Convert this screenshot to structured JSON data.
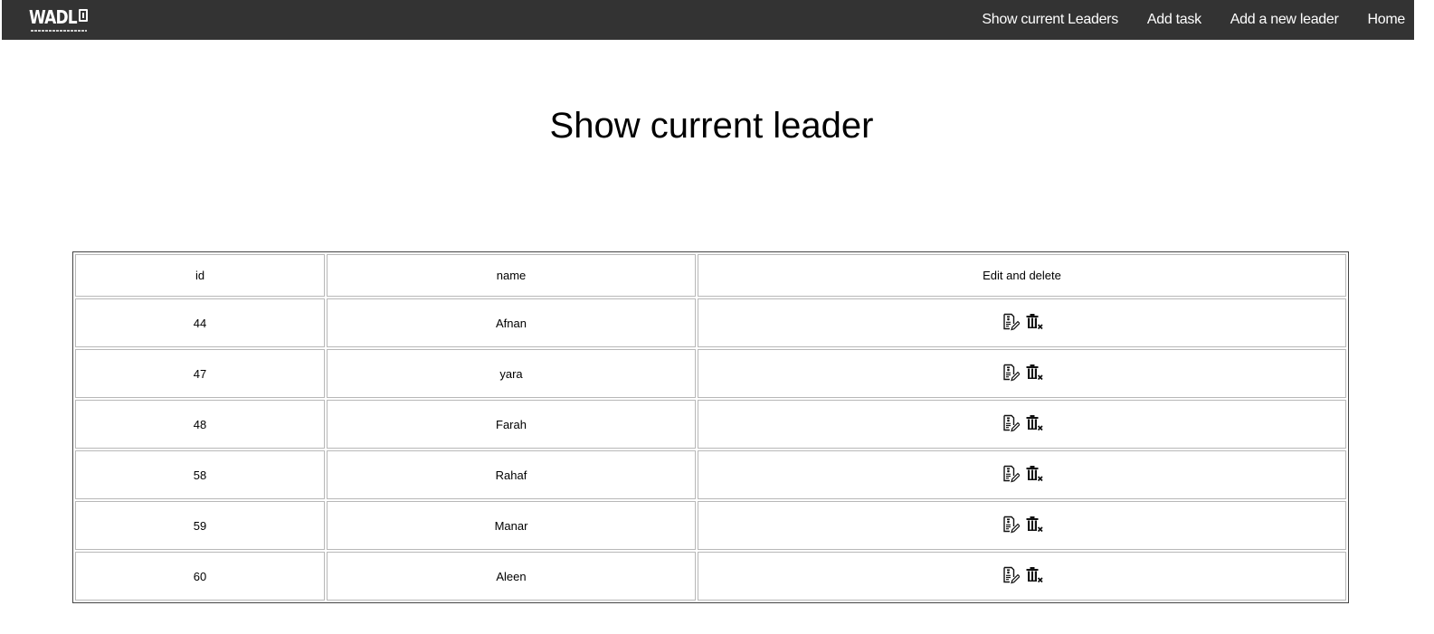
{
  "navbar": {
    "logo_text": "WADL",
    "links": [
      {
        "label": "Show current Leaders"
      },
      {
        "label": "Add task"
      },
      {
        "label": "Add a new leader"
      },
      {
        "label": "Home"
      }
    ]
  },
  "page": {
    "title": "Show current leader"
  },
  "table": {
    "headers": {
      "id": "id",
      "name": "name",
      "actions": "Edit and delete"
    },
    "rows": [
      {
        "id": "44",
        "name": "Afnan"
      },
      {
        "id": "47",
        "name": "yara"
      },
      {
        "id": "48",
        "name": "Farah"
      },
      {
        "id": "58",
        "name": "Rahaf"
      },
      {
        "id": "59",
        "name": "Manar"
      },
      {
        "id": "60",
        "name": "Aleen"
      }
    ],
    "row_icons": [
      "edit-icon",
      "delete-icon"
    ]
  },
  "colors": {
    "navbar_bg": "#333333",
    "nav_text": "#ffffff",
    "table_border": "#444444",
    "cell_border": "#b8b8b8"
  }
}
